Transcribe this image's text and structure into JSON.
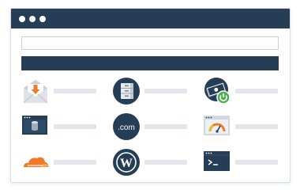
{
  "window": {
    "titlebar_color": "#253d55",
    "controls": [
      "window-dot",
      "window-dot",
      "window-dot"
    ]
  },
  "address_bar": {
    "value": ""
  },
  "tiles": [
    {
      "name": "email",
      "icon": "email-download-icon",
      "label": ""
    },
    {
      "name": "file-manager",
      "icon": "file-cabinet-icon",
      "label": ""
    },
    {
      "name": "billing",
      "icon": "money-power-icon",
      "label": ""
    },
    {
      "name": "database",
      "icon": "database-window-icon",
      "label": ""
    },
    {
      "name": "domains",
      "icon": "dotcom-icon",
      "label": ""
    },
    {
      "name": "performance",
      "icon": "speedometer-window-icon",
      "label": ""
    },
    {
      "name": "cloudflare",
      "icon": "cloud-icon",
      "label": ""
    },
    {
      "name": "wordpress",
      "icon": "wordpress-icon",
      "label": ""
    },
    {
      "name": "terminal",
      "icon": "terminal-icon",
      "label": ""
    }
  ],
  "colors": {
    "navy": "#253d55",
    "orange": "#f07a25",
    "green": "#4caf50",
    "placeholder": "#e3e7ec"
  }
}
